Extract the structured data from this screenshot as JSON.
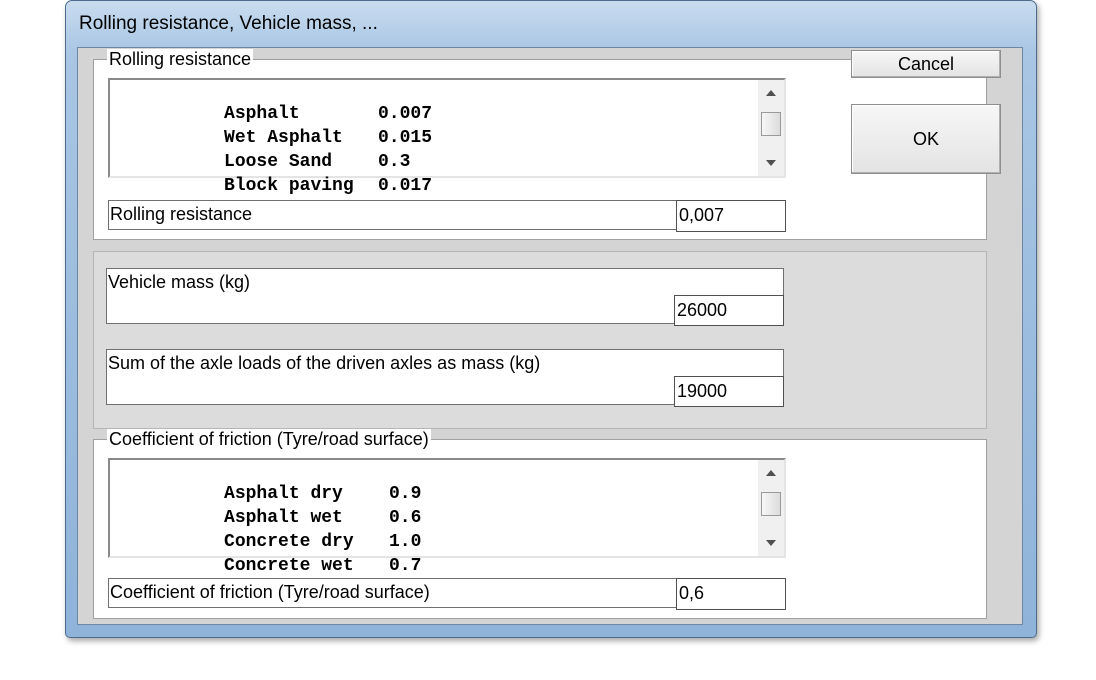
{
  "window": {
    "title": "Rolling resistance, Vehicle mass, ..."
  },
  "buttons": {
    "cancel": "Cancel",
    "ok": "OK"
  },
  "rolling": {
    "legend": "Rolling resistance",
    "list": [
      {
        "name": "Asphalt",
        "value": "0.007"
      },
      {
        "name": "Wet Asphalt",
        "value": "0.015"
      },
      {
        "name": "Loose Sand",
        "value": "0.3"
      },
      {
        "name": "Block paving",
        "value": "0.017"
      }
    ],
    "field_label": "Rolling resistance",
    "field_value": "0,007"
  },
  "mass": {
    "vehicle_label": "Vehicle mass  (kg)",
    "vehicle_value": "26000",
    "axle_label": "Sum of the axle loads of the driven axles as mass  (kg)",
    "axle_value": "19000"
  },
  "friction": {
    "legend": "Coefficient of friction (Tyre/road surface)",
    "list": [
      {
        "name": "Asphalt dry",
        "value": "0.9"
      },
      {
        "name": "Asphalt wet",
        "value": "0.6"
      },
      {
        "name": "Concrete dry",
        "value": "1.0"
      },
      {
        "name": "Concrete wet",
        "value": "0.7"
      }
    ],
    "field_label": "Coefficient of friction (Tyre/road surface)",
    "field_value": "0,6"
  }
}
